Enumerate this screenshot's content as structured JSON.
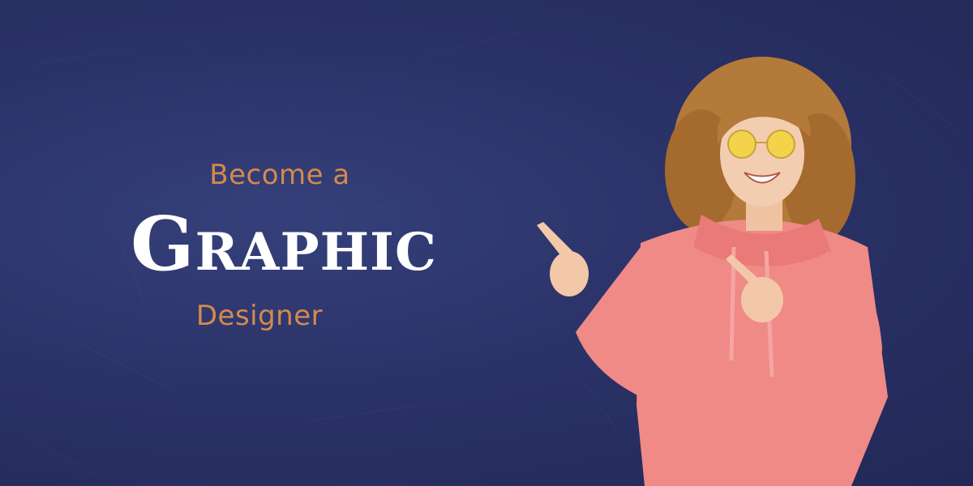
{
  "headline": {
    "top_line": "Become a",
    "main_word": "Graphic",
    "bottom_line": "Designer"
  },
  "colors": {
    "background": "#2a3164",
    "accent_text": "#d48a4c",
    "main_text": "#ffffff",
    "hoodie": "#f08a86"
  },
  "photo": {
    "subject": "smiling woman with curly hair and yellow sunglasses in pink hoodie pointing left"
  }
}
